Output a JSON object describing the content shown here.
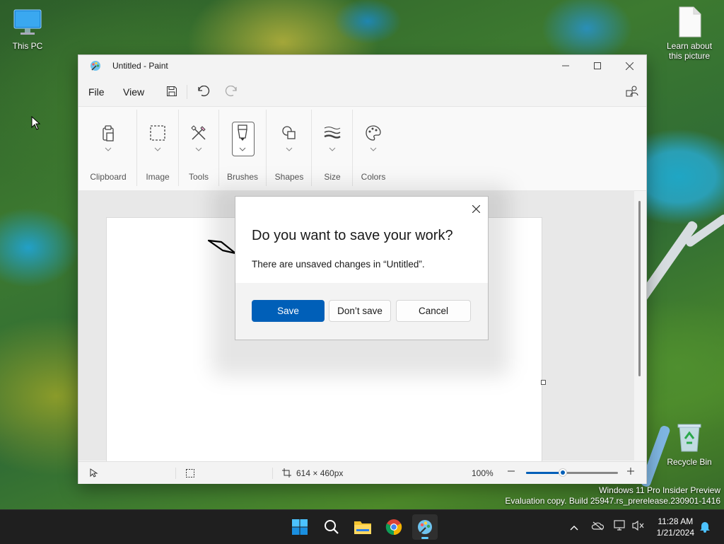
{
  "desktop": {
    "icons": [
      {
        "label": "This PC"
      },
      {
        "label": "Learn about this picture"
      },
      {
        "label": "Recycle Bin"
      }
    ],
    "watermark": {
      "line1": "Windows 11 Pro Insider Preview",
      "line2": "Evaluation copy. Build 25947.rs_prerelease.230901-1416"
    }
  },
  "paint": {
    "title": "Untitled - Paint",
    "menu": {
      "file": "File",
      "view": "View"
    },
    "ribbon": {
      "groups": [
        {
          "label": "Clipboard",
          "icon": "clipboard-icon"
        },
        {
          "label": "Image",
          "icon": "select-icon"
        },
        {
          "label": "Tools",
          "icon": "tools-icon"
        },
        {
          "label": "Brushes",
          "icon": "brush-icon"
        },
        {
          "label": "Shapes",
          "icon": "shapes-icon"
        },
        {
          "label": "Size",
          "icon": "size-icon"
        },
        {
          "label": "Colors",
          "icon": "palette-icon"
        }
      ]
    },
    "status": {
      "canvas_size": "614 × 460px",
      "zoom": "100%",
      "zoom_slider_percent": 40
    }
  },
  "dialog": {
    "heading": "Do you want to save your work?",
    "message": "There are unsaved changes in “Untitled”.",
    "save": "Save",
    "dont_save": "Don’t save",
    "cancel": "Cancel"
  },
  "taskbar": {
    "apps": [
      "start-icon",
      "search-icon",
      "file-explorer-icon",
      "chrome-icon",
      "paint-icon"
    ],
    "time": "11:28 AM",
    "date": "1/21/2024"
  },
  "colors": {
    "accent": "#005fb8",
    "taskbar": "#1f1f1f",
    "indicator": "#60cdff"
  }
}
